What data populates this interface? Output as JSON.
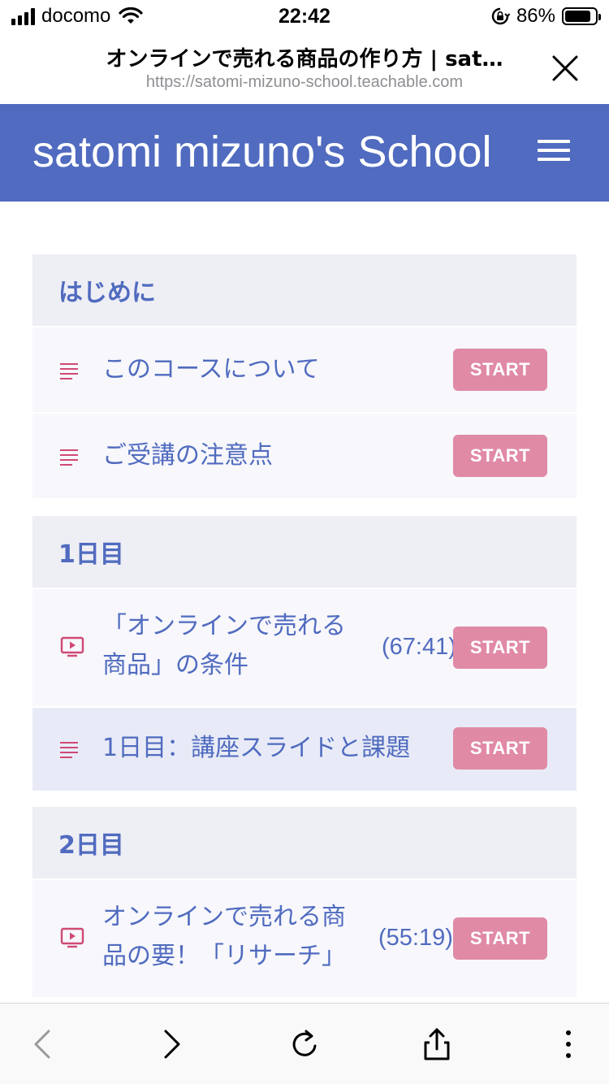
{
  "status_bar": {
    "carrier": "docomo",
    "time": "22:42",
    "battery": "86%",
    "battery_level": 0.86
  },
  "browser": {
    "page_title": "オンラインで売れる商品の作り方 | sat…",
    "url": "https://satomi-mizuno-school.teachable.com"
  },
  "school": {
    "name": "satomi mizuno's School"
  },
  "sections": [
    {
      "title": "はじめに",
      "lectures": [
        {
          "icon": "text-icon",
          "title_lines": [
            "このコースについて"
          ],
          "duration": "",
          "button": "START"
        },
        {
          "icon": "text-icon",
          "title_lines": [
            "ご受講の注意点"
          ],
          "duration": "",
          "button": "START"
        }
      ]
    },
    {
      "title": "1日目",
      "lectures": [
        {
          "icon": "video-icon",
          "title_lines": [
            "「オンラインで売れる",
            "商品」の条件"
          ],
          "duration": "(67:41)",
          "button": "START"
        },
        {
          "icon": "text-icon",
          "title_lines": [
            "1日目：講座スライドと課題"
          ],
          "duration": "",
          "button": "START"
        }
      ]
    },
    {
      "title": "2日目",
      "lectures": [
        {
          "icon": "video-icon",
          "title_lines": [
            "オンラインで売れる商",
            "品の要！「リサーチ」"
          ],
          "duration": "(55:19)",
          "button": "START"
        }
      ]
    }
  ],
  "toolbar": {
    "icons": [
      "back-icon",
      "forward-icon",
      "reload-icon",
      "share-icon",
      "more-icon"
    ]
  },
  "colors": {
    "brand": "#506bbf",
    "start_button": "#e08aa6",
    "icon_accent": "#d04a74",
    "section_bg": "#eeeef5"
  }
}
